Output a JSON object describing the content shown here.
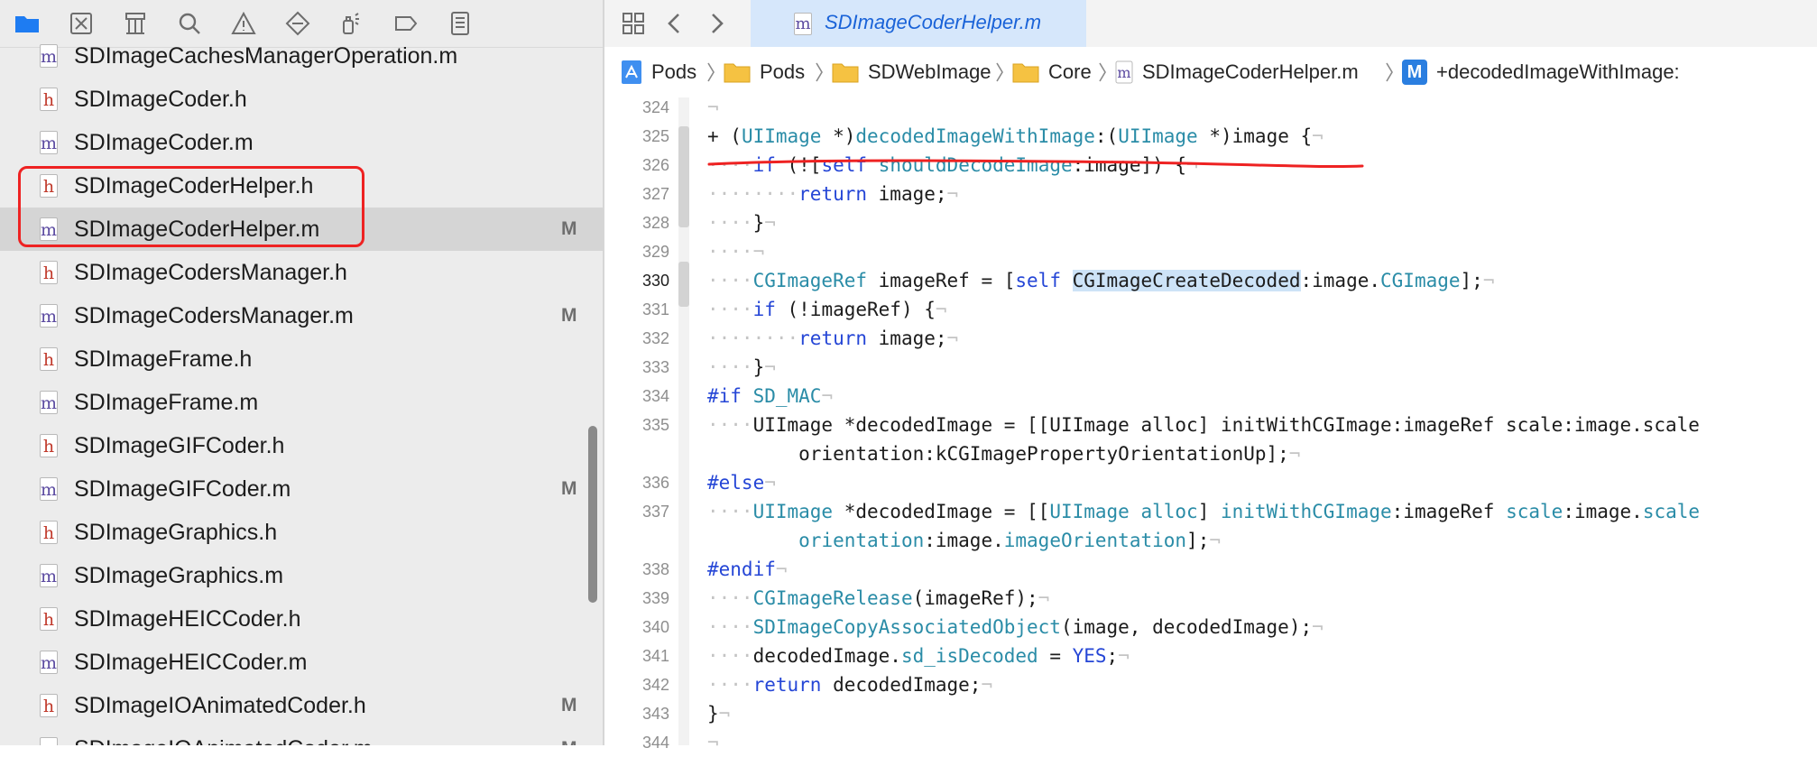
{
  "navigator": {
    "toolbar_icons": [
      "folder-icon",
      "source-control-icon",
      "hierarchy-icon",
      "search-icon",
      "warning-icon",
      "test-diamond-icon",
      "debug-spray-icon",
      "breakpoint-icon",
      "report-icon"
    ],
    "files": [
      {
        "type": "m",
        "name": "SDImageCachesManagerOperation.m",
        "status": ""
      },
      {
        "type": "h",
        "name": "SDImageCoder.h",
        "status": ""
      },
      {
        "type": "m",
        "name": "SDImageCoder.m",
        "status": ""
      },
      {
        "type": "h",
        "name": "SDImageCoderHelper.h",
        "status": ""
      },
      {
        "type": "m",
        "name": "SDImageCoderHelper.m",
        "status": "M",
        "selected": true
      },
      {
        "type": "h",
        "name": "SDImageCodersManager.h",
        "status": ""
      },
      {
        "type": "m",
        "name": "SDImageCodersManager.m",
        "status": "M"
      },
      {
        "type": "h",
        "name": "SDImageFrame.h",
        "status": ""
      },
      {
        "type": "m",
        "name": "SDImageFrame.m",
        "status": ""
      },
      {
        "type": "h",
        "name": "SDImageGIFCoder.h",
        "status": ""
      },
      {
        "type": "m",
        "name": "SDImageGIFCoder.m",
        "status": "M"
      },
      {
        "type": "h",
        "name": "SDImageGraphics.h",
        "status": ""
      },
      {
        "type": "m",
        "name": "SDImageGraphics.m",
        "status": ""
      },
      {
        "type": "h",
        "name": "SDImageHEICCoder.h",
        "status": ""
      },
      {
        "type": "m",
        "name": "SDImageHEICCoder.m",
        "status": ""
      },
      {
        "type": "h",
        "name": "SDImageIOAnimatedCoder.h",
        "status": "M"
      },
      {
        "type": "m",
        "name": "SDImageIOAnimatedCoder.m",
        "status": "M"
      }
    ]
  },
  "editor": {
    "tab_title": "SDImageCoderHelper.m",
    "tab_badge": "m",
    "breadcrumb": [
      "Pods",
      "Pods",
      "SDWebImage",
      "Core",
      "SDImageCoderHelper.m",
      "+decodedImageWithImage:"
    ],
    "method_badge": "M",
    "current_line": "330"
  },
  "code": {
    "lines": [
      {
        "n": "324",
        "segs": [
          [
            "inv",
            "¬"
          ]
        ]
      },
      {
        "n": "325",
        "segs": [
          [
            "p",
            "+ ("
          ],
          [
            "ty",
            "UIImage"
          ],
          [
            "p",
            " *)"
          ],
          [
            "fn",
            "decodedImageWithImage"
          ],
          [
            "p",
            ":("
          ],
          [
            "ty",
            "UIImage"
          ],
          [
            "p",
            " *)image {"
          ],
          [
            "inv",
            "¬"
          ]
        ]
      },
      {
        "n": "326",
        "segs": [
          [
            "inv",
            "····"
          ],
          [
            "kw",
            "if"
          ],
          [
            "p",
            " (!["
          ],
          [
            "kw",
            "self"
          ],
          [
            "p",
            " "
          ],
          [
            "fn",
            "shouldDecodeImage"
          ],
          [
            "p",
            ":image]) {"
          ],
          [
            "inv",
            "¬"
          ]
        ]
      },
      {
        "n": "327",
        "segs": [
          [
            "inv",
            "········"
          ],
          [
            "kw",
            "return"
          ],
          [
            "p",
            " image;"
          ],
          [
            "inv",
            "¬"
          ]
        ]
      },
      {
        "n": "328",
        "segs": [
          [
            "inv",
            "····"
          ],
          [
            "p",
            "}"
          ],
          [
            "inv",
            "¬"
          ]
        ]
      },
      {
        "n": "329",
        "segs": [
          [
            "inv",
            "····¬"
          ]
        ]
      },
      {
        "n": "330",
        "segs": [
          [
            "inv",
            "····"
          ],
          [
            "ty",
            "CGImageRef"
          ],
          [
            "p",
            " imageRef = ["
          ],
          [
            "kw",
            "self"
          ],
          [
            "p",
            " "
          ],
          [
            "hl",
            "CGImageCreateDecoded"
          ],
          [
            "p",
            ":image."
          ],
          [
            "ty",
            "CGImage"
          ],
          [
            "p",
            "];"
          ],
          [
            "inv",
            "¬"
          ]
        ]
      },
      {
        "n": "331",
        "segs": [
          [
            "inv",
            "····"
          ],
          [
            "kw",
            "if"
          ],
          [
            "p",
            " (!imageRef) {"
          ],
          [
            "inv",
            "¬"
          ]
        ]
      },
      {
        "n": "332",
        "segs": [
          [
            "inv",
            "········"
          ],
          [
            "kw",
            "return"
          ],
          [
            "p",
            " image;"
          ],
          [
            "inv",
            "¬"
          ]
        ]
      },
      {
        "n": "333",
        "segs": [
          [
            "inv",
            "····"
          ],
          [
            "p",
            "}"
          ],
          [
            "inv",
            "¬"
          ]
        ]
      },
      {
        "n": "334",
        "segs": [
          [
            "pp",
            "#if"
          ],
          [
            "p",
            " "
          ],
          [
            "ty",
            "SD_MAC"
          ],
          [
            "inv",
            "¬"
          ]
        ]
      },
      {
        "n": "335",
        "segs": [
          [
            "inv",
            "····"
          ],
          [
            "p",
            "UIImage *decodedImage = [[UIImage alloc] initWithCGImage:imageRef scale:image.scale"
          ]
        ]
      },
      {
        "n": "",
        "segs": [
          [
            "p",
            "        orientation:kCGImagePropertyOrientationUp];"
          ],
          [
            "inv",
            "¬"
          ]
        ]
      },
      {
        "n": "336",
        "segs": [
          [
            "pp",
            "#else"
          ],
          [
            "inv",
            "¬"
          ]
        ]
      },
      {
        "n": "337",
        "segs": [
          [
            "inv",
            "····"
          ],
          [
            "ty",
            "UIImage"
          ],
          [
            "p",
            " *decodedImage = [["
          ],
          [
            "ty",
            "UIImage"
          ],
          [
            "p",
            " "
          ],
          [
            "fn",
            "alloc"
          ],
          [
            "p",
            "] "
          ],
          [
            "fn",
            "initWithCGImage"
          ],
          [
            "p",
            ":imageRef "
          ],
          [
            "fn",
            "scale"
          ],
          [
            "p",
            ":image."
          ],
          [
            "fn",
            "scale"
          ]
        ]
      },
      {
        "n": "",
        "segs": [
          [
            "p",
            "        "
          ],
          [
            "fn",
            "orientation"
          ],
          [
            "p",
            ":image."
          ],
          [
            "fn",
            "imageOrientation"
          ],
          [
            "p",
            "];"
          ],
          [
            "inv",
            "¬"
          ]
        ]
      },
      {
        "n": "338",
        "segs": [
          [
            "pp",
            "#endif"
          ],
          [
            "inv",
            "¬"
          ]
        ]
      },
      {
        "n": "339",
        "segs": [
          [
            "inv",
            "····"
          ],
          [
            "fn",
            "CGImageRelease"
          ],
          [
            "p",
            "(imageRef);"
          ],
          [
            "inv",
            "¬"
          ]
        ]
      },
      {
        "n": "340",
        "segs": [
          [
            "inv",
            "····"
          ],
          [
            "fn",
            "SDImageCopyAssociatedObject"
          ],
          [
            "p",
            "(image, decodedImage);"
          ],
          [
            "inv",
            "¬"
          ]
        ]
      },
      {
        "n": "341",
        "segs": [
          [
            "inv",
            "····"
          ],
          [
            "p",
            "decodedImage."
          ],
          [
            "fn",
            "sd_isDecoded"
          ],
          [
            "p",
            " = "
          ],
          [
            "kw",
            "YES"
          ],
          [
            "p",
            ";"
          ],
          [
            "inv",
            "¬"
          ]
        ]
      },
      {
        "n": "342",
        "segs": [
          [
            "inv",
            "····"
          ],
          [
            "kw",
            "return"
          ],
          [
            "p",
            " decodedImage;"
          ],
          [
            "inv",
            "¬"
          ]
        ]
      },
      {
        "n": "343",
        "segs": [
          [
            "p",
            "}"
          ],
          [
            "inv",
            "¬"
          ]
        ]
      },
      {
        "n": "344",
        "segs": [
          [
            "inv",
            "¬"
          ]
        ]
      }
    ]
  },
  "colors": {
    "keyword": "#2546d6",
    "type": "#2a8ca7",
    "annotation_red": "#ee2222",
    "selection_row": "#d5d5d5",
    "tab_active": "#d6e7fb"
  }
}
